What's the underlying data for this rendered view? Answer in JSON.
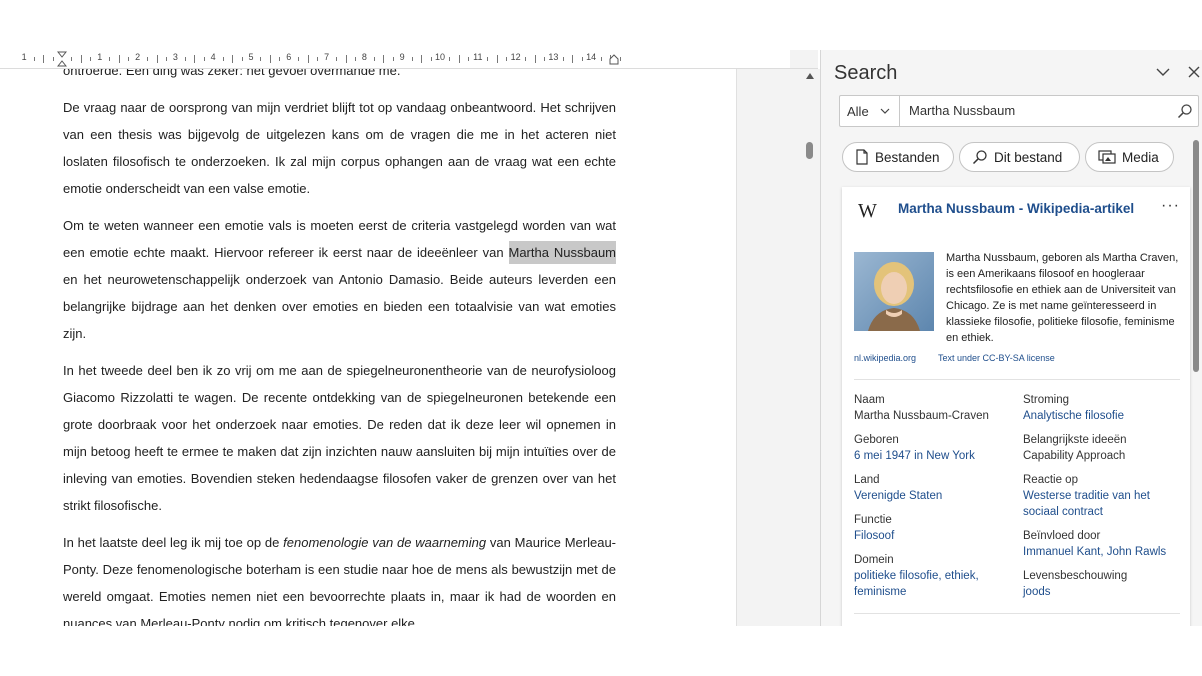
{
  "ruler": {
    "numbers": [
      "1",
      "1",
      "2",
      "3",
      "4",
      "5",
      "6",
      "7",
      "8",
      "9",
      "10",
      "11",
      "12",
      "13",
      "14"
    ]
  },
  "document": {
    "cut_top": "ontroerde. Één ding was zeker: het gevoel overmande me.",
    "p1": "De vraag naar de oorsprong van mijn verdriet blijft tot op vandaag onbeantwoord. Het schrijven van een thesis was bijgevolg de uitgelezen kans om de vragen die me in het acteren niet loslaten filosofisch te onderzoeken. Ik zal mijn corpus ophangen aan de vraag wat een echte emotie onderscheidt van een valse emotie.",
    "p2_before": "Om te weten wanneer een emotie vals is moeten eerst de criteria vastgelegd worden van wat een emotie echte maakt. Hiervoor refereer ik eerst naar de ideeënleer van ",
    "p2_highlight": "Martha Nussbaum",
    "p2_after": " en het neurowetenschappelijk onderzoek van Antonio Damasio. Beide auteurs leverden een belangrijke bijdrage aan het denken over emoties en bieden een totaalvisie van wat emoties zijn.",
    "p3": "In het tweede deel ben ik zo vrij om me aan de spiegelneuronentheorie van de neurofysioloog Giacomo Rizzolatti te wagen. De recente ontdekking van de spiegelneuronen betekende een grote doorbraak voor het onderzoek naar emoties. De reden dat ik deze leer wil opnemen in mijn betoog heeft te ermee te maken dat zijn inzichten nauw aansluiten bij mijn intuïties over de inleving van emoties. Bovendien steken hedendaagse filosofen vaker de grenzen over van het strikt filosofische.",
    "p4_before": "In het laatste deel leg ik mij toe op de ",
    "p4_italic": "fenomenologie van de waarneming",
    "p4_after": " van Maurice Merleau-Ponty. Deze fenomenologische boterham is een studie naar hoe de mens als bewustzijn met de wereld omgaat. Emoties nemen niet een bevoorrechte plaats in, maar ik had de woorden en nuances van Merleau-Ponty nodig om kritisch tegenover elke"
  },
  "pane": {
    "title": "Search",
    "scope": "Alle",
    "query": "Martha Nussbaum",
    "chips": {
      "files": "Bestanden",
      "this_file": "Dit bestand",
      "media": "Media"
    },
    "card": {
      "logo": "W",
      "title": "Martha Nussbaum - Wikipedia-artikel",
      "more": "···",
      "summary": "Martha Nussbaum, geboren als Martha Craven, is een Amerikaans filosoof en hoogleraar rechtsfilosofie en ethiek aan de Universiteit van Chicago. Ze is met name geïnteresseerd in klassieke filosofie, politieke filosofie, feminisme en ethiek.",
      "source": "nl.wikipedia.org",
      "license": "Text under CC-BY-SA license",
      "left": [
        {
          "label": "Naam",
          "value": "Martha Nussbaum-Craven"
        },
        {
          "label": "Geboren",
          "value": "6 mei 1947 in New York"
        },
        {
          "label": "Land",
          "value": "Verenigde Staten"
        },
        {
          "label": "Functie",
          "value": "Filosoof"
        },
        {
          "label": "Domein",
          "value": "politieke filosofie, ethiek, feminisme"
        }
      ],
      "right": [
        {
          "label": "Stroming",
          "value": "Analytische filosofie"
        },
        {
          "label": "Belangrijkste ideeën",
          "value": "Capability Approach"
        },
        {
          "label": "Reactie op",
          "value": "Westerse traditie van het sociaal contract"
        },
        {
          "label": "Beïnvloed door",
          "value": "Immanuel Kant, John Rawls"
        },
        {
          "label": "Levensbeschouwing",
          "value": "joods"
        }
      ]
    }
  },
  "colors": {
    "link": "#1f4e8c",
    "highlight": "#c8c8c8",
    "pane_bg": "#f5f5f5"
  }
}
